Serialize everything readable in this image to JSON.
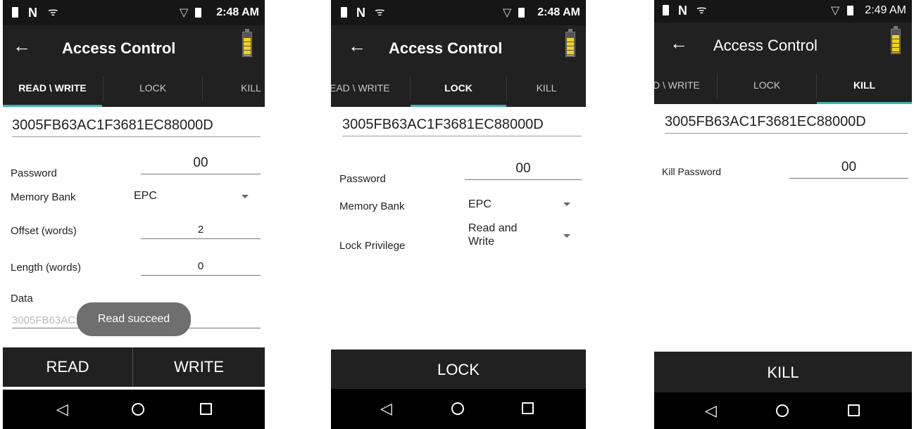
{
  "status": {
    "time1": "2:48 AM",
    "time2": "2:48 AM",
    "time3": "2:49 AM"
  },
  "app": {
    "title": "Access Control",
    "back": "←"
  },
  "tabs": {
    "rw": "READ \\ WRITE",
    "rw_clipped_1": "EAD \\ WRITE",
    "rw_clipped_2": "D \\ WRITE",
    "lock": "LOCK",
    "kill": "KILL",
    "kill_clipped": "KILL"
  },
  "tag_epc": "3005FB63AC1F3681EC88000D",
  "screen1": {
    "password_label": "Password",
    "password_value": "00",
    "memory_bank_label": "Memory Bank",
    "memory_bank_value": "EPC",
    "offset_label": "Offset (words)",
    "offset_value": "2",
    "length_label": "Length (words)",
    "length_value": "0",
    "data_label": "Data",
    "data_value": "3005FB63AC1F3681EC88000D",
    "toast": "Read succeed",
    "read_button": "READ",
    "write_button": "WRITE"
  },
  "screen2": {
    "password_label": "Password",
    "password_value": "00",
    "memory_bank_label": "Memory Bank",
    "memory_bank_value": "EPC",
    "lock_privilege_label": "Lock Privilege",
    "lock_privilege_value": "Read and Write",
    "lock_button": "LOCK"
  },
  "screen3": {
    "kill_password_label": "Kill Password",
    "kill_password_value": "00",
    "kill_button": "KILL"
  },
  "nav": {
    "back": "◁",
    "home": "home-circle",
    "recent": "recent-square"
  },
  "colors": {
    "appbar": "#212121",
    "statusbar": "#161616",
    "tab_indicator": "#3fb5b0",
    "battery": "#f1d21f",
    "toast": "#6f6f6f"
  }
}
